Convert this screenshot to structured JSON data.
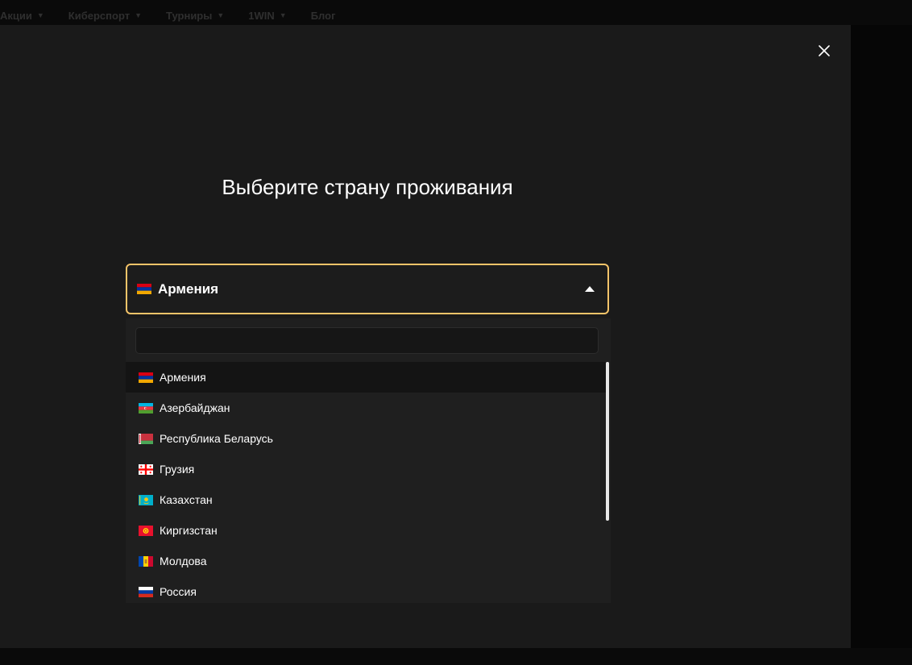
{
  "nav": {
    "items": [
      {
        "label": "Акции"
      },
      {
        "label": "Киберспорт"
      },
      {
        "label": "Турниры"
      },
      {
        "label": "1WIN"
      },
      {
        "label": "Блог"
      }
    ]
  },
  "modal": {
    "title": "Выберите страну проживания",
    "close_icon": "close-icon"
  },
  "select": {
    "selected": {
      "label": "Армения",
      "flag": "armenia"
    },
    "expanded": true
  },
  "dropdown": {
    "search": {
      "value": "",
      "placeholder": ""
    },
    "items": [
      {
        "label": "Армения",
        "flag": "armenia",
        "active": true
      },
      {
        "label": "Азербайджан",
        "flag": "azerbaijan",
        "active": false
      },
      {
        "label": "Республика Беларусь",
        "flag": "belarus",
        "active": false
      },
      {
        "label": "Грузия",
        "flag": "georgia",
        "active": false
      },
      {
        "label": "Казахстан",
        "flag": "kazakhstan",
        "active": false
      },
      {
        "label": "Киргизстан",
        "flag": "kyrgyzstan",
        "active": false
      },
      {
        "label": "Молдова",
        "flag": "moldova",
        "active": false
      },
      {
        "label": "Россия",
        "flag": "russia",
        "active": false
      }
    ]
  },
  "colors": {
    "accent_border": "#f5c469",
    "modal_bg": "#1a1a1a",
    "dropdown_bg": "#1f1f1f",
    "active_item_bg": "#141414"
  }
}
